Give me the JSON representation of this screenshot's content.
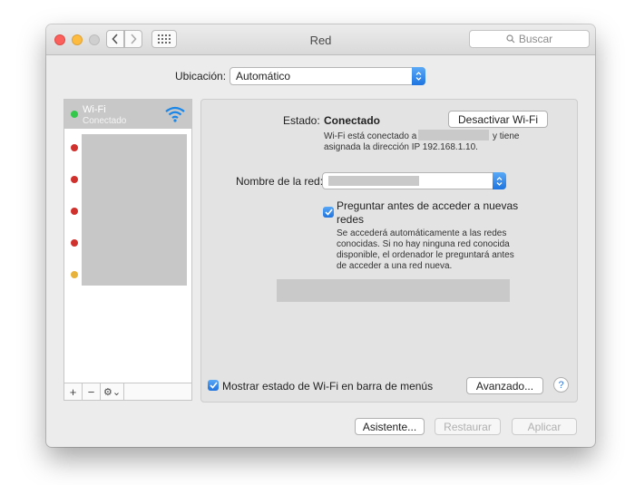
{
  "window": {
    "title": "Red",
    "search_placeholder": "Buscar"
  },
  "location": {
    "label": "Ubicación:",
    "value": "Automático"
  },
  "sidebar": {
    "selected": {
      "name": "Wi-Fi",
      "status": "Conectado",
      "status_color": "#34c84a"
    },
    "items": [
      {
        "status_color": "#d0312d"
      },
      {
        "status_color": "#d0312d"
      },
      {
        "status_color": "#d0312d"
      },
      {
        "status_color": "#d0312d"
      },
      {
        "status_color": "#e8b33a"
      }
    ],
    "tools": {
      "add": "+",
      "remove": "−",
      "action": "⚙⌄"
    }
  },
  "status": {
    "label": "Estado:",
    "value": "Conectado",
    "toggle_button": "Desactivar Wi-Fi",
    "desc_line1_prefix": "Wi-Fi está conectado a",
    "desc_line1_suffix": "y tiene",
    "desc_line2": "asignada la dirección IP 192.168.1.10."
  },
  "network": {
    "label": "Nombre de la red:"
  },
  "ask_networks": {
    "label_line1": "Preguntar antes de acceder a nuevas",
    "label_line2": "redes",
    "desc": [
      "Se accederá automáticamente a las redes",
      "conocidas. Si no hay ninguna red conocida",
      "disponible, el ordenador le preguntará antes",
      "de acceder a una red nueva."
    ],
    "checked": true
  },
  "footer_panel": {
    "show_status_label": "Mostrar estado de Wi-Fi en barra de menús",
    "advanced_button": "Avanzado...",
    "help": "?"
  },
  "bottom_buttons": {
    "assistant": "Asistente...",
    "revert": "Restaurar",
    "apply": "Aplicar"
  }
}
